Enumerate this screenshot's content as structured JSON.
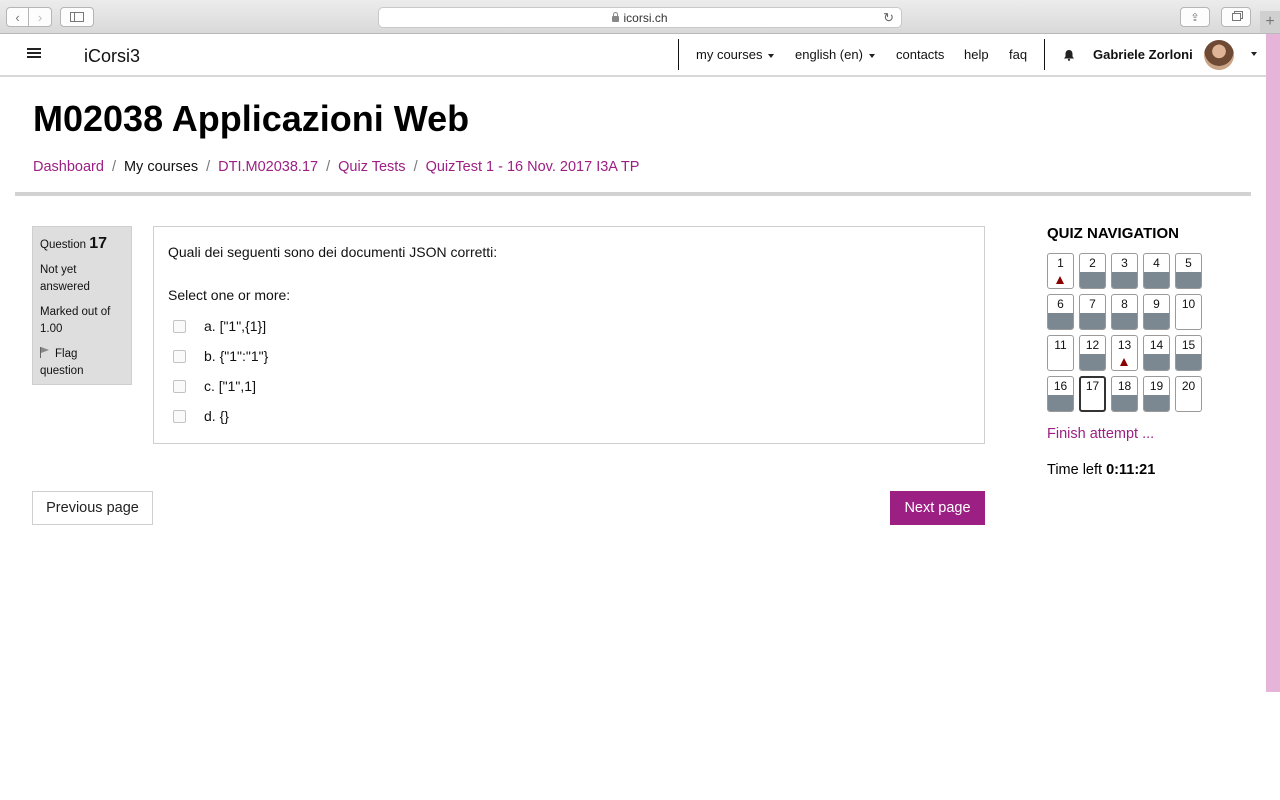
{
  "browser": {
    "url": "icorsi.ch",
    "back_icon": "‹",
    "forward_icon": "›",
    "reload_icon": "↻",
    "share_icon": "⇪",
    "new_tab_icon": "+"
  },
  "navbar": {
    "brand": "iCorsi3",
    "my_courses": "my courses",
    "language": "english (en)",
    "contacts": "contacts",
    "help": "help",
    "faq": "faq",
    "user_name": "Gabriele Zorloni"
  },
  "page": {
    "title": "M02038 Applicazioni Web",
    "breadcrumb": [
      "Dashboard",
      "My courses",
      "DTI.M02038.17",
      "Quiz Tests",
      "QuizTest 1 - 16 Nov. 2017 I3A TP"
    ],
    "breadcrumb_sep": "/"
  },
  "question_info": {
    "label": "Question",
    "number": "17",
    "status": "Not yet answered",
    "marked": "Marked out of 1.00",
    "flag": "Flag question"
  },
  "question": {
    "text": "Quali dei seguenti sono dei documenti JSON corretti:",
    "prompt": "Select one or more:",
    "answers": [
      "a. [\"1\",{1}]",
      "b. {\"1\":\"1\"}",
      "c. [\"1\",1]",
      "d. {}"
    ]
  },
  "buttons": {
    "previous": "Previous page",
    "next": "Next page"
  },
  "quiz_nav": {
    "title": "QUIZ NAVIGATION",
    "items": [
      {
        "n": "1",
        "state": "flagged"
      },
      {
        "n": "2",
        "state": "answered"
      },
      {
        "n": "3",
        "state": "answered"
      },
      {
        "n": "4",
        "state": "answered"
      },
      {
        "n": "5",
        "state": "answered"
      },
      {
        "n": "6",
        "state": "answered"
      },
      {
        "n": "7",
        "state": "answered"
      },
      {
        "n": "8",
        "state": "answered"
      },
      {
        "n": "9",
        "state": "answered"
      },
      {
        "n": "10",
        "state": "unanswered"
      },
      {
        "n": "11",
        "state": "unanswered"
      },
      {
        "n": "12",
        "state": "answered"
      },
      {
        "n": "13",
        "state": "flagged"
      },
      {
        "n": "14",
        "state": "answered"
      },
      {
        "n": "15",
        "state": "answered"
      },
      {
        "n": "16",
        "state": "answered"
      },
      {
        "n": "17",
        "state": "current"
      },
      {
        "n": "18",
        "state": "answered"
      },
      {
        "n": "19",
        "state": "answered"
      },
      {
        "n": "20",
        "state": "unanswered"
      }
    ],
    "finish": "Finish attempt ...",
    "time_label": "Time left",
    "time_value": "0:11:21"
  },
  "colors": {
    "accent": "#9c1f83",
    "answered": "#7b8791",
    "flag": "#8b0000"
  }
}
